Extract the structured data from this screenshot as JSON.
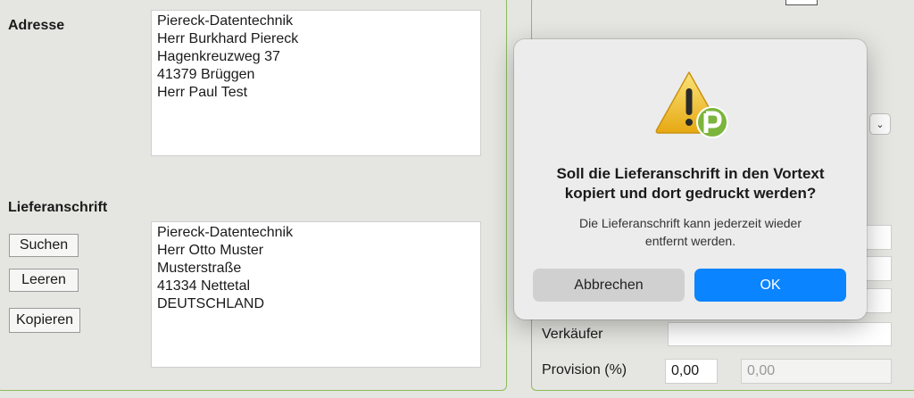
{
  "left": {
    "address_label": "Adresse",
    "address_lines": [
      "Piereck-Datentechnik",
      "Herr Burkhard Piereck",
      "Hagenkreuzweg 37",
      "41379 Brüggen",
      "Herr Paul Test"
    ],
    "delivery_label": "Lieferanschrift",
    "delivery_lines": [
      "Piereck-Datentechnik",
      "Herr Otto Muster",
      "Musterstraße",
      "41334 Nettetal",
      "DEUTSCHLAND"
    ],
    "buttons": {
      "search": "Suchen",
      "clear": "Leeren",
      "copy": "Kopieren"
    }
  },
  "right": {
    "seller_label": "Verkäufer",
    "seller_value": "",
    "commission_label": "Provision (%)",
    "commission_value": "0,00",
    "commission_value_2": "0,00"
  },
  "dialog": {
    "title_line1": "Soll die Lieferanschrift in den Vortext",
    "title_line2": "kopiert und dort gedruckt werden?",
    "message_line1": "Die Lieferanschrift kann jederzeit wieder",
    "message_line2": "entfernt werden.",
    "cancel_label": "Abbrechen",
    "ok_label": "OK",
    "icon": "warning-icon",
    "app_badge": "P"
  },
  "colors": {
    "background": "#e5e5e1",
    "panel_border": "#8cbd5a",
    "accent": "#0b84ff",
    "warning": "#f2c12e",
    "app_badge": "#7bb53c"
  }
}
